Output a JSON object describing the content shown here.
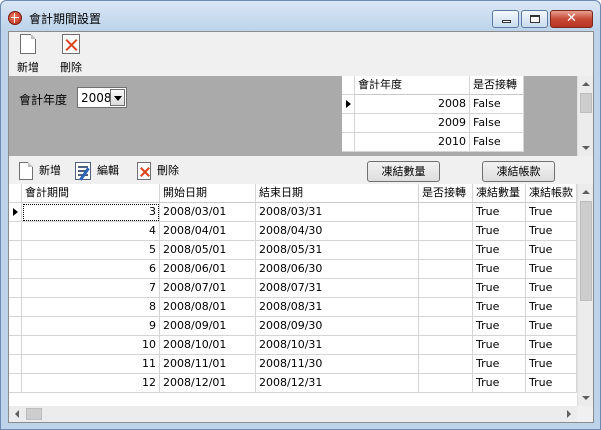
{
  "window": {
    "title": "會計期間設置"
  },
  "toolbar_top": {
    "new_label": "新增",
    "delete_label": "刪除"
  },
  "year_panel": {
    "label": "會計年度",
    "selected_year": "2008"
  },
  "year_grid": {
    "columns": [
      "會計年度",
      "是否接轉"
    ],
    "rows": [
      {
        "year": "2008",
        "closed": "False"
      },
      {
        "year": "2009",
        "closed": "False"
      },
      {
        "year": "2010",
        "closed": "False"
      }
    ]
  },
  "toolbar_period": {
    "new_label": "新增",
    "edit_label": "編輯",
    "delete_label": "刪除",
    "freeze_qty_label": "凍結數量",
    "freeze_account_label": "凍結帳款"
  },
  "period_grid": {
    "columns": [
      "會計期間",
      "開始日期",
      "結束日期",
      "是否接轉",
      "凍結數量",
      "凍結帳款"
    ],
    "rows": [
      {
        "period": "3",
        "start": "2008/03/01",
        "end": "2008/03/31",
        "closed": "",
        "freeze_qty": "True",
        "freeze_account": "True"
      },
      {
        "period": "4",
        "start": "2008/04/01",
        "end": "2008/04/30",
        "closed": "",
        "freeze_qty": "True",
        "freeze_account": "True"
      },
      {
        "period": "5",
        "start": "2008/05/01",
        "end": "2008/05/31",
        "closed": "",
        "freeze_qty": "True",
        "freeze_account": "True"
      },
      {
        "period": "6",
        "start": "2008/06/01",
        "end": "2008/06/30",
        "closed": "",
        "freeze_qty": "True",
        "freeze_account": "True"
      },
      {
        "period": "7",
        "start": "2008/07/01",
        "end": "2008/07/31",
        "closed": "",
        "freeze_qty": "True",
        "freeze_account": "True"
      },
      {
        "period": "8",
        "start": "2008/08/01",
        "end": "2008/08/31",
        "closed": "",
        "freeze_qty": "True",
        "freeze_account": "True"
      },
      {
        "period": "9",
        "start": "2008/09/01",
        "end": "2008/09/30",
        "closed": "",
        "freeze_qty": "True",
        "freeze_account": "True"
      },
      {
        "period": "10",
        "start": "2008/10/01",
        "end": "2008/10/31",
        "closed": "",
        "freeze_qty": "True",
        "freeze_account": "True"
      },
      {
        "period": "11",
        "start": "2008/11/01",
        "end": "2008/11/30",
        "closed": "",
        "freeze_qty": "True",
        "freeze_account": "True"
      },
      {
        "period": "12",
        "start": "2008/12/01",
        "end": "2008/12/31",
        "closed": "",
        "freeze_qty": "True",
        "freeze_account": "True"
      }
    ]
  }
}
